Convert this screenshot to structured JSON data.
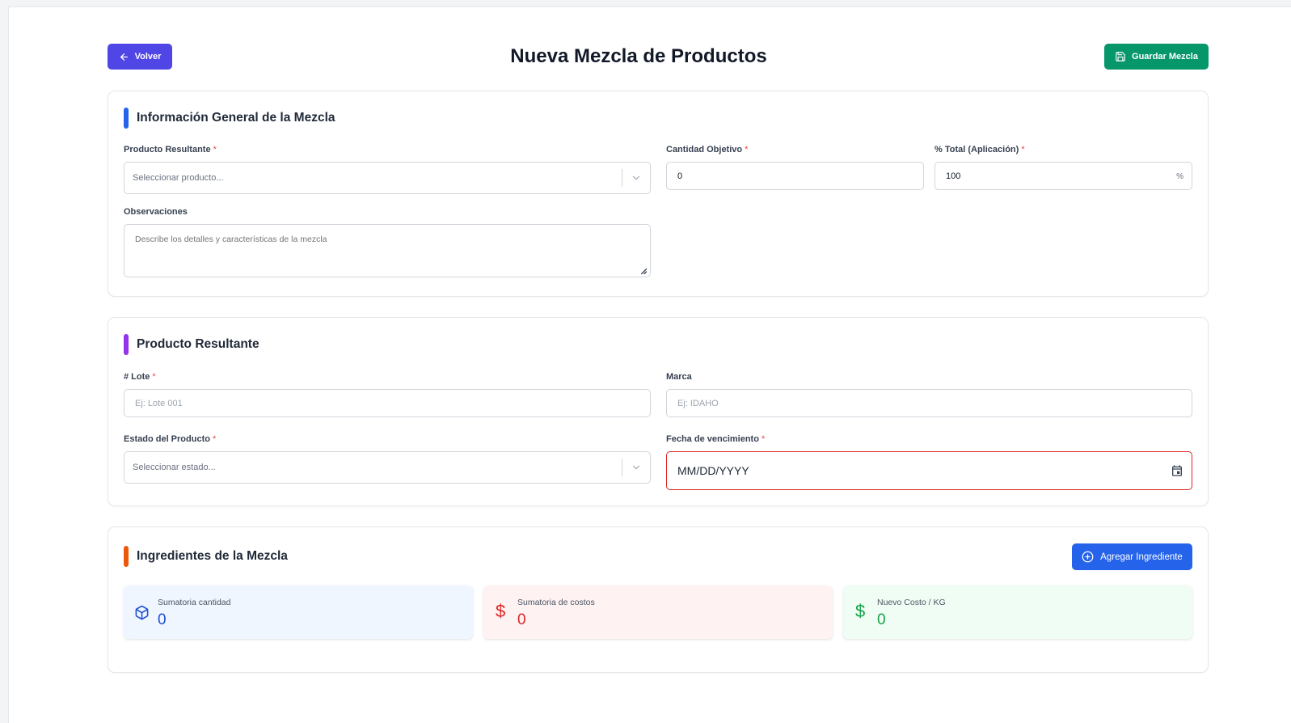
{
  "header": {
    "title": "Nueva Mezcla de Productos",
    "back_label": "Volver",
    "save_label": "Guardar Mezcla"
  },
  "general": {
    "section_title": "Información General de la Mezcla",
    "accent": "#2563eb",
    "product_label": "Producto Resultante",
    "product_placeholder": "Seleccionar producto...",
    "quantity_label": "Cantidad Objetivo",
    "quantity_value": "0",
    "percent_label": "% Total (Aplicación)",
    "percent_value": "100",
    "percent_suffix": "%",
    "notes_label": "Observaciones",
    "notes_placeholder": "Describe los detalles y características de la mezcla",
    "required_mark": "*"
  },
  "result": {
    "section_title": "Producto Resultante",
    "accent": "#9333ea",
    "lot_label": "# Lote",
    "lot_placeholder": "Ej: Lote 001",
    "brand_label": "Marca",
    "brand_placeholder": "Ej: IDAHO",
    "state_label": "Estado del Producto",
    "state_placeholder": "Seleccionar estado...",
    "expiry_label": "Fecha de vencimiento",
    "expiry_value": "MM/DD/YYYY"
  },
  "ingredients": {
    "section_title": "Ingredientes de la Mezcla",
    "accent": "#ea580c",
    "add_label": "Agregar Ingrediente",
    "stats": {
      "qty_label": "Sumatoria cantidad",
      "qty_value": "0",
      "cost_label": "Sumatoria de costos",
      "cost_value": "0",
      "newcost_label": "Nuevo Costo / KG",
      "newcost_value": "0",
      "currency_symbol": "$"
    }
  }
}
